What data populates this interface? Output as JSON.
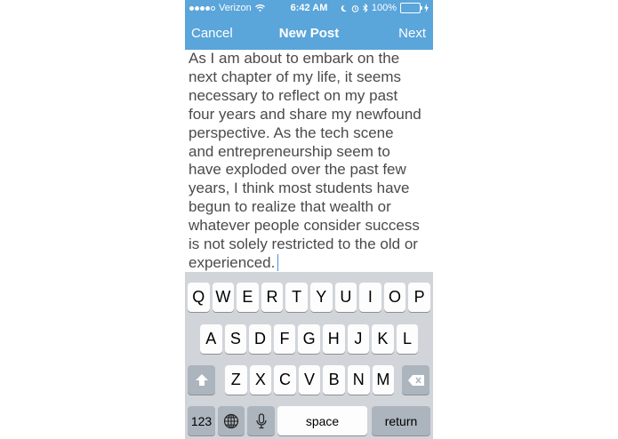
{
  "status_bar": {
    "carrier": "Verizon",
    "time": "6:42 AM",
    "battery": "100%",
    "icons": [
      "signal-dots-icon",
      "wifi-icon",
      "moon-icon",
      "alarm-icon",
      "bluetooth-icon",
      "battery-icon",
      "charging-bolt-icon"
    ],
    "battery_level": 1.0
  },
  "navbar": {
    "cancel_label": "Cancel",
    "title": "New Post",
    "next_label": "Next",
    "color": "#5aa5da"
  },
  "post": {
    "text": "As I am about to embark on the\nnext chapter of my life, it seems\nnecessary to reflect on my past\nfour years and share my newfound\nperspective. As the tech scene\nand entrepreneurship seem to\nhave exploded over the past few\nyears, I think most students have\nbegun to realize that wealth or\nwhatever people consider success\nis not solely restricted to the old or\nexperienced."
  },
  "keyboard": {
    "row1": [
      "Q",
      "W",
      "E",
      "R",
      "T",
      "Y",
      "U",
      "I",
      "O",
      "P"
    ],
    "row2": [
      "A",
      "S",
      "D",
      "F",
      "G",
      "H",
      "J",
      "K",
      "L"
    ],
    "row3": [
      "Z",
      "X",
      "C",
      "V",
      "B",
      "N",
      "M"
    ],
    "numbers_label": "123",
    "space_label": "space",
    "return_label": "return",
    "icons": [
      "shift-icon",
      "delete-icon",
      "globe-icon",
      "microphone-icon"
    ]
  }
}
